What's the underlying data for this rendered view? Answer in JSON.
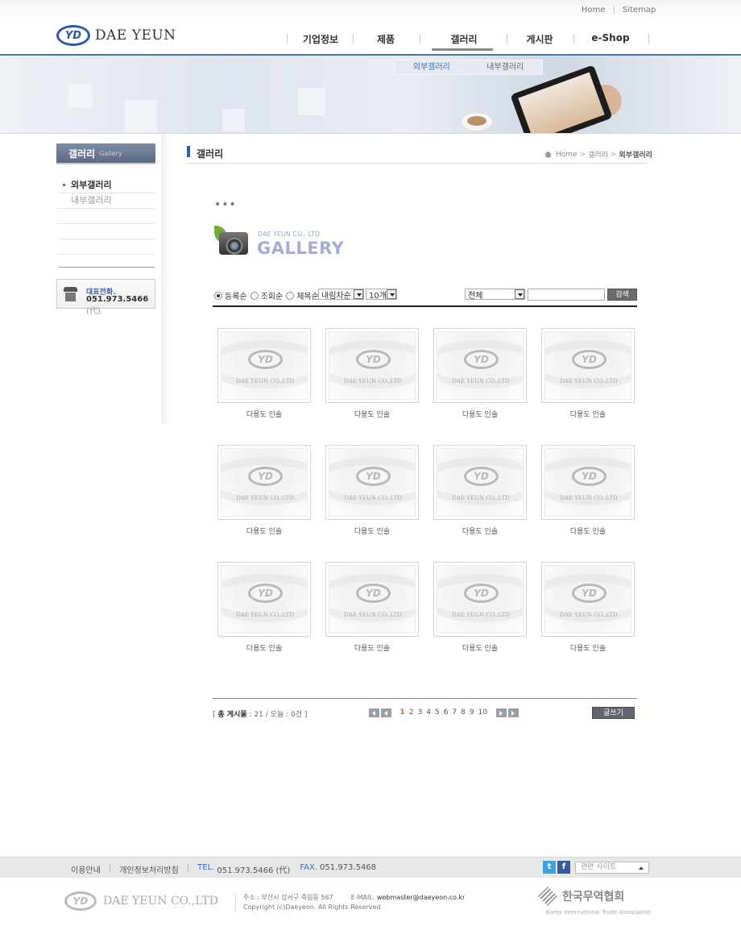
{
  "header": {
    "util_links": [
      "Home",
      "Sitemap"
    ],
    "logo_mark": "YD",
    "logo_text": "DAE YEUN",
    "gnb": [
      "기업정보",
      "제품",
      "갤러리",
      "게시판",
      "e-Shop"
    ],
    "active_gnb": "갤러리",
    "subnav": [
      "외부갤러리",
      "내부갤러리"
    ],
    "active_subnav": "외부갤러리"
  },
  "sidebar": {
    "title": "갤러리",
    "title_en": "Gallery",
    "items": [
      "외부갤러리",
      "내부갤러리"
    ],
    "tel_label": "대표전화.",
    "tel_number": "051.973.5466",
    "tel_suffix": "(代)"
  },
  "content": {
    "title": "갤러리",
    "breadcrumb": [
      "Home",
      "갤러리",
      "외부갤러리"
    ],
    "dots": "•••",
    "gallery_sub": "DAE YEUN CO., LTD",
    "gallery_title": "GALLERY"
  },
  "search": {
    "sort_options": [
      "등록순",
      "조회순",
      "제목순"
    ],
    "sort_selected": "등록순",
    "order_value": "내림차순",
    "count_value": "10개",
    "field_value": "전체",
    "query": "",
    "button": "검색"
  },
  "gallery": {
    "watermark": "DAE YEUN CO.,LTD",
    "items": [
      {
        "caption": "다용도 인솔"
      },
      {
        "caption": "다용도 인솔"
      },
      {
        "caption": "다용도 인솔"
      },
      {
        "caption": "다용도 인솔"
      },
      {
        "caption": "다용도 인솔"
      },
      {
        "caption": "다용도 인솔"
      },
      {
        "caption": "다용도 인솔"
      },
      {
        "caption": "다용도 인솔"
      },
      {
        "caption": "다용도 인솔"
      },
      {
        "caption": "다용도 인솔"
      },
      {
        "caption": "다용도 인솔"
      },
      {
        "caption": "다용도 인솔"
      }
    ]
  },
  "list_footer": {
    "total_open": "[",
    "total_label": "총 게시물",
    "total_count": ": 21",
    "today_label": "/ 오늘",
    "today_count": ": 0건",
    "total_close": "]",
    "pages": [
      "1",
      "2",
      "3",
      "4",
      "5",
      "6",
      "7",
      "8",
      "9",
      "10"
    ],
    "current_page": "1",
    "write_button": "글쓰기"
  },
  "footer": {
    "links": [
      "이용안내",
      "개인정보처리방침"
    ],
    "tel_label": "TEL.",
    "tel": "051.973.5466 (代)",
    "fax_label": "FAX.",
    "fax": "051.973.5468",
    "related_placeholder": "관련 사이트",
    "sns": [
      "t",
      "f"
    ],
    "logo_text": "DAE YEUN CO.,LTD",
    "address": "주소 : 부산시 강서구 죽림동 567",
    "email_label": "E-MAIL.",
    "email": "webmaster@daeyeon.co.kr",
    "copyright": "Copyright (c)Daeyeon. All Rights Reserved.",
    "partner_name": "한국무역협회",
    "partner_en": "Korea International Trade Association"
  },
  "colors": {
    "brand_blue": "#2c5aa8",
    "accent_orange": "#e0632e"
  }
}
